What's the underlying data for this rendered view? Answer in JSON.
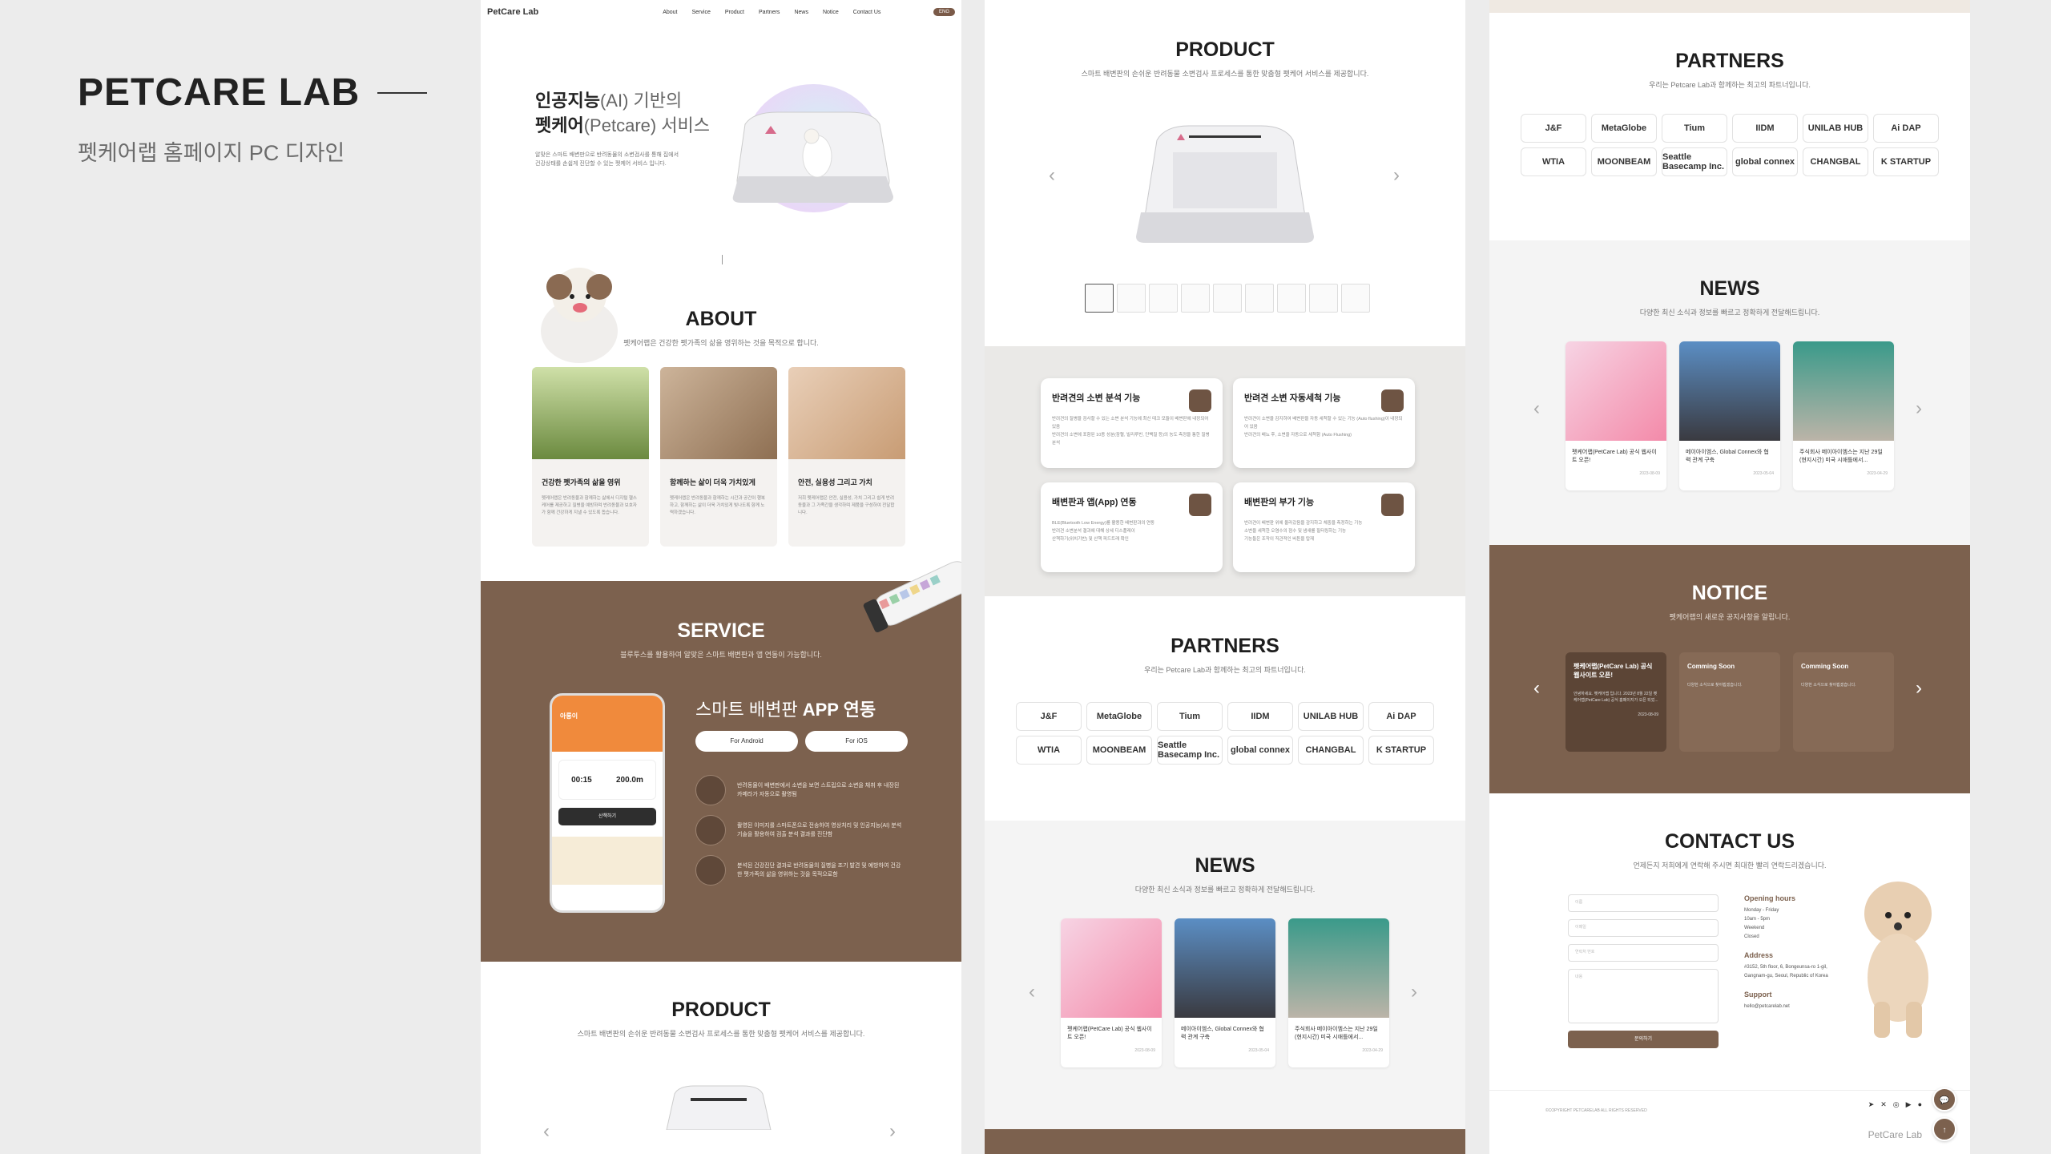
{
  "brand": {
    "title": "PETCARE LAB",
    "subtitle": "펫케어랩 홈페이지 PC 디자인"
  },
  "nav": {
    "logo": "PetCare Lab",
    "items": [
      "About",
      "Service",
      "Product",
      "Partners",
      "News",
      "Notice",
      "Contact Us"
    ],
    "lang": "ENG"
  },
  "hero": {
    "line1_bold": "인공지능",
    "line1_rest": "(AI) 기반의",
    "line2_bold": "펫케어",
    "line2_rest": "(Petcare) 서비스",
    "desc": "알맞은 스마트 배변판으로 반려동물의 소변검사를 통해 집에서 건강상태를 손쉽게 진단할 수 있는 펫케어 서비스 입니다."
  },
  "about": {
    "title": "ABOUT",
    "sub": "펫케어랩은 건강한 펫가족의 삶을 영위하는 것을 목적으로 합니다.",
    "cards": [
      {
        "title": "건강한 펫가족의 삶을 영위",
        "desc": "펫케어랩은 반려동물과 함께하는 삶에서 디지털 헬스케어를 제공하고 질병을 예방하며 반려동물과 보호자가 함께 건강하게 지낼 수 있도록 돕습니다."
      },
      {
        "title": "함께하는 삶이 더욱 가치있게",
        "desc": "펫케어랩은 반려동물과 함께하는 시간과 공간이 행복하고, 함께하는 삶이 더욱 가치있게 빛나도록 함께 노력하겠습니다."
      },
      {
        "title": "안전, 실용성 그리고 가치",
        "desc": "저희 펫케어랩은 안전, 실용성, 가치 그리고 쉽게 반려동물과 그 가족간을 생각하며 제품을 구성하여 전달합니다."
      }
    ]
  },
  "service": {
    "title": "SERVICE",
    "sub": "블루투스를 활용하여 알맞은 스마트 배변판과 앱 연동이 가능합니다.",
    "heading_light": "스마트 배변판",
    "heading_bold": "APP 연동",
    "btn_android": "For Android",
    "btn_ios": "For iOS",
    "features": [
      "반려동물이 배변판에서 소변을 보면 스트립으로 소변을 채취 후 내장된 카메라가 자동으로 촬영됨",
      "촬영된 이미지를 스마트폰으로 전송하여 영상처리 및 인공지능(AI) 분석 기술을 활용하여 검출 분석 결과를 진단함",
      "분석된 건강진단 결과로 반려동물의 질병을 조기 발견 및 예방하여 건강한 펫가족의 삶을 영위하는 것을 목적으로함"
    ],
    "phone": {
      "name": "아롱이",
      "time": "00:15",
      "distance": "200.0m",
      "btn": "산책하기"
    }
  },
  "product": {
    "title": "PRODUCT",
    "sub": "스마트 배변판의 손쉬운 반려동물 소변검사 프로세스를 통한 맞춤형 펫케어 서비스를 제공합니다."
  },
  "functions": [
    {
      "title": "반려견의 소변 분석 기능",
      "lines": [
        "반려견의 질병을 검사할 수 있는 소변 분석 기능에 최신 테크 모듈이 배변판에 내장되어 있음",
        "반려견의 소변에 포함된 10종 성분(잠혈, 빌리루빈, 단백질 등)의 농도 측정을 통한 질병 분석"
      ]
    },
    {
      "title": "반려견 소변 자동세척 기능",
      "lines": [
        "반려견이 소변을 감지하여 배변판을 자동 세척할 수 있는 기능 (Auto flushing)이 내장되어 있음",
        "반려견의 배뇨 후, 소변을 자동으로 세척함 (Auto Flushing)"
      ]
    },
    {
      "title": "배변판과 앱(App) 연동",
      "lines": [
        "BLE(Bluetooth Low Energy)를 활용한 배변판과의 연동",
        "반려견 소변분석 결과에 대해 상세 디스플레이",
        "산책하기(위치기반) 및 산책 피드트래 확인"
      ]
    },
    {
      "title": "배변판의 부가 기능",
      "lines": [
        "반려견이 배변판 위에 올라갔음을 감지하고 체중을 측정하는 기능",
        "소변을 세척한 오염수의 점수 및 냄새를 필터링하는 기능",
        "기능들은 조작이 직관적인 버튼을 탑재"
      ]
    }
  ],
  "partners": {
    "title": "PARTNERS",
    "sub": "우리는 Petcare Lab과 함께하는 최고의 파트너입니다.",
    "row1": [
      "J&F",
      "MetaGlobe",
      "Tium",
      "IIDM",
      "UNILAB HUB",
      "Ai DAP"
    ],
    "row2": [
      "WTIA",
      "MOONBEAM",
      "Seattle Basecamp Inc.",
      "global connex",
      "CHANGBAL",
      "K STARTUP"
    ]
  },
  "news": {
    "title": "NEWS",
    "sub": "다양한 최신 소식과 정보를 빠르고 정확하게 전달해드립니다.",
    "items": [
      {
        "title": "펫케어랩(PetCare Lab) 공식 웹사이트 오픈!",
        "date": "2023-08-09"
      },
      {
        "title": "메이아이엠스, Global Connex와 협력 관계 구축",
        "date": "2023-05-04"
      },
      {
        "title": "주식회사 메이아이엠스는 지난 29일(현지시간) 미국 시애틀에서...",
        "date": "2023-04-29"
      }
    ]
  },
  "notice": {
    "title": "NOTICE",
    "sub": "펫케어랩의 새로운 공지사항을 알립니다.",
    "items": [
      {
        "title": "펫케어랩(PetCare Lab) 공식 웹사이트 오픈!",
        "desc": "안녕하세요. 펫케어랩 입니다. 2023년 8월 22일 펫케어랩(PetCare Lab) 공식 홈페이지가 오픈 되었...",
        "date": "2023-08-09"
      },
      {
        "title": "Comming Soon",
        "desc": "다양한 소식으로 찾아뵙겠습니다."
      },
      {
        "title": "Comming Soon",
        "desc": "다양한 소식으로 찾아뵙겠습니다."
      }
    ]
  },
  "contact": {
    "title": "CONTACT US",
    "sub": "언제든지 저희에게 연락해 주시면 최대한 빨리 연락드리겠습니다.",
    "fields": [
      "이름",
      "이메일",
      "연락처 번호",
      "내용"
    ],
    "submit": "문의하기",
    "hours_title": "Opening hours",
    "hours": [
      "Monday - Friday",
      "10am - 5pm",
      "Weekend",
      "Closed"
    ],
    "address_title": "Address",
    "address": [
      "#3152, 5th floor, 6, Bongeunsa-ro 1-gil,",
      "Gangnam-gu, Seoul, Republic of Korea"
    ],
    "support_title": "Support",
    "support": "hello@petcarelab.net"
  },
  "footer": {
    "copyright": "©COPYRIGHT PETCARELAB ALL RIGHTS RESERVED",
    "brand": "PetCare Lab"
  },
  "colors": {
    "brown": "#7c614e",
    "dark_brown": "#5c4536",
    "orange": "#f08a3c"
  }
}
